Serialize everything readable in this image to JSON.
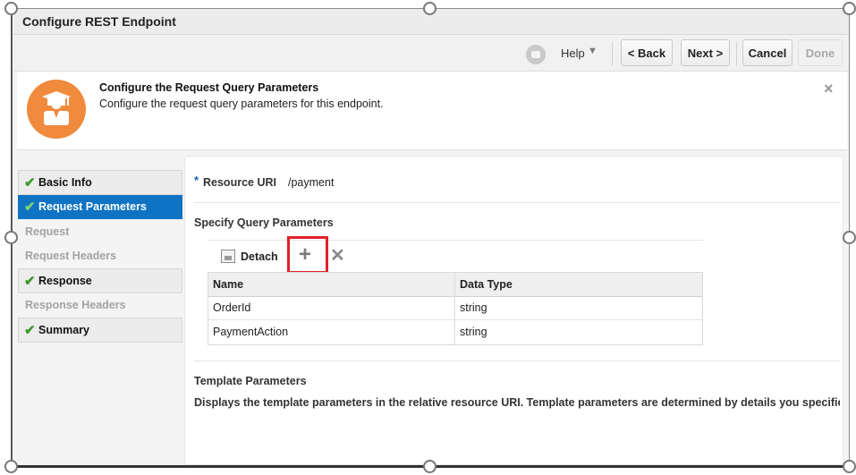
{
  "dialog": {
    "title": "Configure REST Endpoint"
  },
  "toolbar": {
    "help_label": "Help",
    "help_caret": "▼",
    "back_label": "< Back",
    "next_label": "Next >",
    "cancel_label": "Cancel",
    "done_label": "Done"
  },
  "header": {
    "title": "Configure the Request Query Parameters",
    "description": "Configure the request query parameters for this endpoint.",
    "close_glyph": "×"
  },
  "train": {
    "items": [
      {
        "label": "Basic Info",
        "state": "done"
      },
      {
        "label": "Request Parameters",
        "state": "active"
      },
      {
        "label": "Request",
        "state": "pending"
      },
      {
        "label": "Request Headers",
        "state": "pending"
      },
      {
        "label": "Response",
        "state": "done"
      },
      {
        "label": "Response Headers",
        "state": "pending"
      },
      {
        "label": "Summary",
        "state": "done"
      }
    ],
    "check_glyph": "✔"
  },
  "resource": {
    "required_marker": "*",
    "label": "Resource URI",
    "value": "/payment"
  },
  "query_params": {
    "section_title": "Specify Query Parameters",
    "detach_label": "Detach",
    "add_glyph": "+",
    "delete_glyph": "✕",
    "columns": [
      "Name",
      "Data Type"
    ],
    "rows": [
      {
        "name": "OrderId",
        "type": "string"
      },
      {
        "name": "PaymentAction",
        "type": "string"
      }
    ]
  },
  "template_params": {
    "section_title": "Template Parameters",
    "description": "Displays the template parameters in the relative resource URI. Template parameters are determined by details you specified c"
  },
  "colors": {
    "accent": "#0f73c4",
    "icon_orange": "#f08a3c",
    "highlight_red": "#e0202a",
    "check_green": "#3a9a2a"
  }
}
